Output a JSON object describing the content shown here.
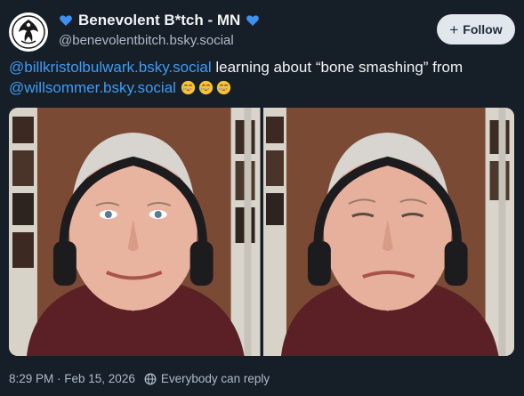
{
  "author": {
    "display_name": "Benevolent B*tch - MN",
    "handle": "@benevolentbitch.bsky.social",
    "heart_color": "#3f8ff0",
    "avatar_icon": "phoenix-logo-icon"
  },
  "follow_button": {
    "label": "Follow",
    "icon": "plus-icon"
  },
  "post": {
    "mention_1": "@billkristolbulwark.bsky.social",
    "text_1": " learning about “bone smashing” from ",
    "mention_2": "@willsommer.bsky.social",
    "emojis": [
      "smiling-face-with-tear-icon",
      "smiling-face-with-tear-icon",
      "smiling-face-with-tear-icon"
    ]
  },
  "media": {
    "count": 2,
    "images": [
      "face-photo-left",
      "face-photo-right"
    ]
  },
  "footer": {
    "timestamp": "8:29 PM · Feb 15, 2026",
    "reply_setting": "Everybody can reply",
    "reply_icon": "globe-icon"
  },
  "colors": {
    "background": "#161e27",
    "link": "#3f9bf5",
    "muted": "#aebbc9"
  }
}
